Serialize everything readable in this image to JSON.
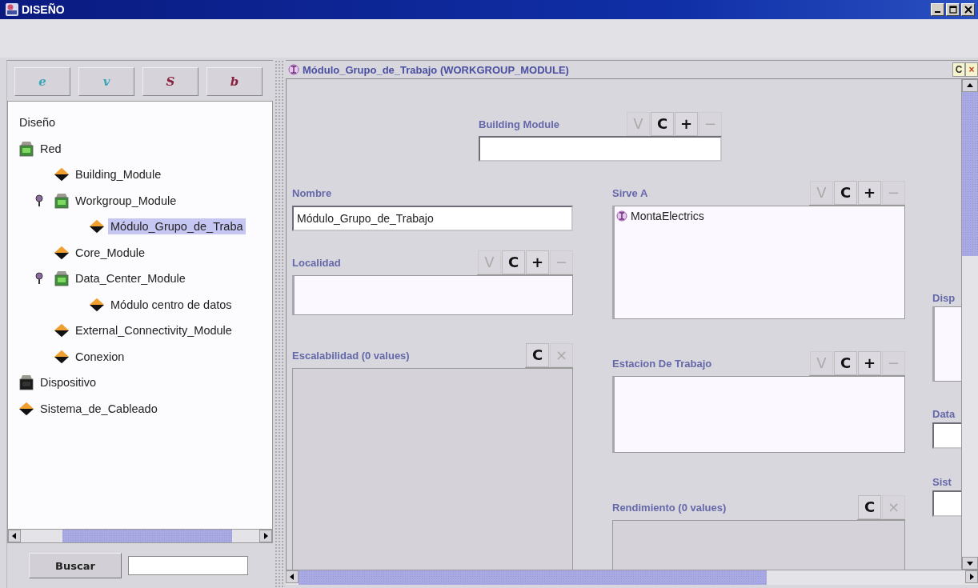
{
  "window": {
    "title": "DISEÑO"
  },
  "toolbar": [
    {
      "label": "e",
      "color": "#3aa7b8"
    },
    {
      "label": "v",
      "color": "#3aa7b8"
    },
    {
      "label": "S",
      "color": "#8a2040"
    },
    {
      "label": "b",
      "color": "#8a2040"
    }
  ],
  "tree": {
    "root": "Diseño",
    "items": [
      {
        "label": "Red",
        "kind": "container",
        "selected": false,
        "children": [
          {
            "label": "Building_Module",
            "kind": "item",
            "selected": false
          },
          {
            "label": "Workgroup_Module",
            "kind": "container",
            "selected": false,
            "expanded": true,
            "children": [
              {
                "label": "Módulo_Grupo_de_Traba",
                "kind": "item",
                "selected": true
              }
            ]
          },
          {
            "label": "Core_Module",
            "kind": "item",
            "selected": false
          },
          {
            "label": "Data_Center_Module",
            "kind": "container",
            "selected": false,
            "expanded": true,
            "children": [
              {
                "label": "Módulo centro de datos",
                "kind": "item",
                "selected": false
              }
            ]
          },
          {
            "label": "External_Connectivity_Module",
            "kind": "item",
            "selected": false
          },
          {
            "label": "Conexion",
            "kind": "item",
            "selected": false
          }
        ]
      },
      {
        "label": "Dispositivo",
        "kind": "abstract",
        "selected": false
      },
      {
        "label": "Sistema_de_Cableado",
        "kind": "item",
        "selected": false
      }
    ]
  },
  "search": {
    "button": "Buscar"
  },
  "form": {
    "title": "Módulo_Grupo_de_Trabajo (WORKGROUP_MODULE)",
    "header_buttons": [
      {
        "label": "C"
      },
      {
        "label": "×"
      }
    ],
    "top_field": {
      "label": "Building Module",
      "kind": "text",
      "buttons": [
        {
          "label": "V",
          "disabled": true
        },
        {
          "label": "C",
          "disabled": false
        },
        {
          "label": "+",
          "disabled": false
        },
        {
          "label": "−",
          "disabled": true
        }
      ]
    },
    "left_column": [
      {
        "label": "Nombre",
        "kind": "text",
        "value": "Módulo_Grupo_de_Trabajo"
      },
      {
        "label": "Localidad",
        "kind": "list",
        "buttons": [
          {
            "label": "V",
            "disabled": true
          },
          {
            "label": "C",
            "disabled": false
          },
          {
            "label": "+",
            "disabled": false
          },
          {
            "label": "−",
            "disabled": true
          }
        ]
      },
      {
        "label": "Escalabilidad (0 values)",
        "kind": "values",
        "buttons": [
          {
            "label": "C",
            "disabled": false
          },
          {
            "label": "×",
            "disabled": true
          }
        ]
      }
    ],
    "middle_column": [
      {
        "label": "Sirve A",
        "kind": "list",
        "items": [
          {
            "text": "MontaElectrics"
          }
        ],
        "buttons": [
          {
            "label": "V",
            "disabled": true
          },
          {
            "label": "C",
            "disabled": false
          },
          {
            "label": "+",
            "disabled": false
          },
          {
            "label": "−",
            "disabled": true
          }
        ]
      },
      {
        "label": "Estacion De Trabajo",
        "kind": "list",
        "buttons": [
          {
            "label": "V",
            "disabled": true
          },
          {
            "label": "C",
            "disabled": false
          },
          {
            "label": "+",
            "disabled": false
          },
          {
            "label": "−",
            "disabled": true
          }
        ]
      },
      {
        "label": "Rendimiento (0 values)",
        "kind": "values",
        "buttons": [
          {
            "label": "C",
            "disabled": false
          },
          {
            "label": "×",
            "disabled": true
          }
        ]
      }
    ],
    "right_column": [
      {
        "label": "Disp",
        "kind": "list"
      },
      {
        "label": "Data",
        "kind": "text"
      },
      {
        "label": "Sist",
        "kind": "text"
      }
    ]
  }
}
